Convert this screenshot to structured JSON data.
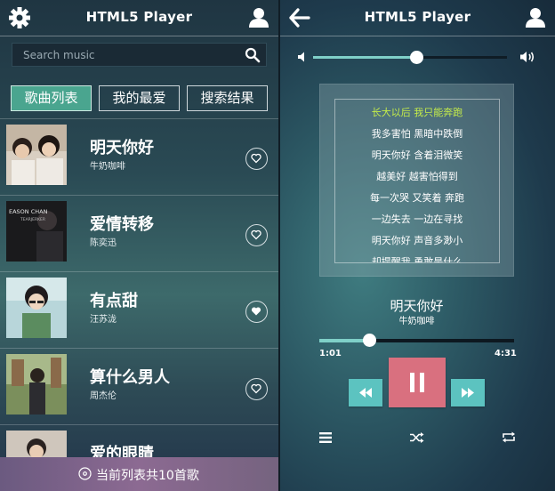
{
  "left": {
    "header": {
      "title": "HTML5 Player",
      "settings_icon": "gear-icon",
      "user_icon": "user-icon"
    },
    "search": {
      "placeholder": "Search music",
      "icon": "search-icon"
    },
    "tabs": [
      {
        "label": "歌曲列表",
        "active": true
      },
      {
        "label": "我的最爱",
        "active": false
      },
      {
        "label": "搜索结果",
        "active": false
      }
    ],
    "songs": [
      {
        "name": "明天你好",
        "artist": "牛奶咖啡",
        "favorite": false
      },
      {
        "name": "爱情转移",
        "artist": "陈奕迅",
        "favorite": false,
        "cover_text": [
          "EASON CHAN",
          "TEARJERKER"
        ]
      },
      {
        "name": "有点甜",
        "artist": "汪苏泷",
        "favorite": true
      },
      {
        "name": "算什么男人",
        "artist": "周杰伦",
        "favorite": false
      },
      {
        "name": "爱的眼睛",
        "artist": "",
        "favorite": false
      }
    ],
    "footer": {
      "label": "当前列表共10首歌",
      "icon": "disc-icon"
    }
  },
  "right": {
    "header": {
      "title": "HTML5 Player",
      "back_icon": "back-arrow-icon",
      "user_icon": "user-icon"
    },
    "volume": {
      "level": 0.53,
      "mute_icon": "volume-low-icon",
      "max_icon": "volume-high-icon"
    },
    "lyrics": [
      "长大以后 我只能奔跑",
      "我多害怕 黑暗中跌倒",
      "明天你好 含着泪微笑",
      "越美好 越害怕得到",
      "每一次哭 又笑着 奔跑",
      "一边失去 一边在寻找",
      "明天你好 声音多渺小",
      "却提醒我 勇敢是什么"
    ],
    "now_playing": {
      "name": "明天你好",
      "artist": "牛奶咖啡"
    },
    "progress": {
      "current": "1:01",
      "total": "4:31",
      "fraction": 0.255
    },
    "controls": {
      "prev_icon": "rewind-icon",
      "play_icon": "pause-icon",
      "next_icon": "fast-forward-icon"
    },
    "bottom_icons": [
      "list-icon",
      "shuffle-icon",
      "repeat-icon"
    ],
    "colors": {
      "accent": "#5cc3c0",
      "lyric_highlight": "#c4ec4a",
      "play_button": "#d9707f",
      "tab_active": "#4aa58f"
    }
  }
}
